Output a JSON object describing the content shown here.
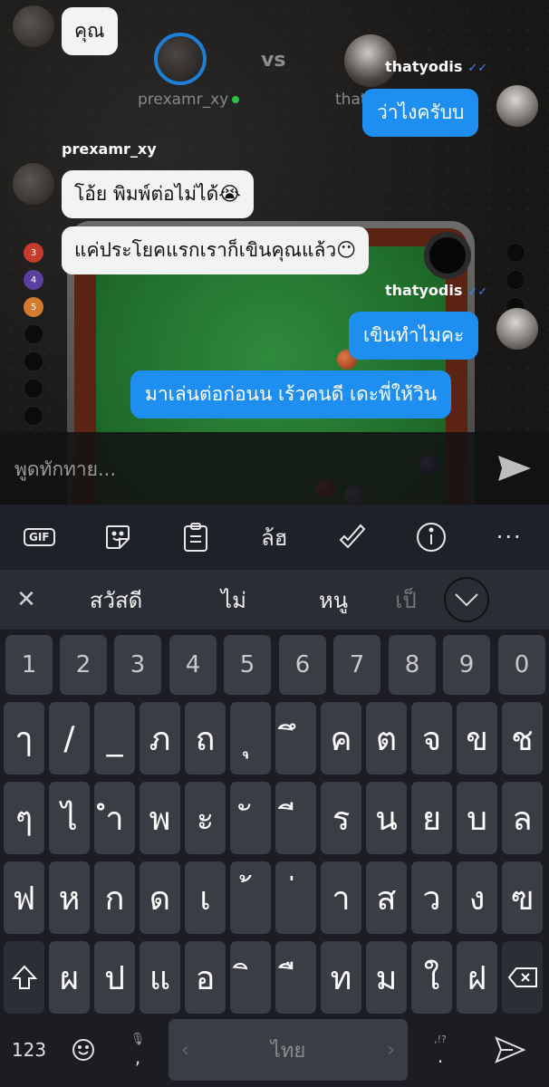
{
  "game": {
    "player1": {
      "name": "prexamr_xy"
    },
    "vs_label": "vs",
    "player2": {
      "name": "thatyodis",
      "name_partial": "that"
    },
    "rack_left": [
      "3",
      "4",
      "5"
    ]
  },
  "chat": {
    "messages": [
      {
        "sender": "",
        "text": "คุณ",
        "direction": "in"
      },
      {
        "sender": "thatyodis",
        "text": "ว่าไงครับบ",
        "direction": "out"
      },
      {
        "sender": "prexamr_xy",
        "text": "โอ้ย พิมพ์ต่อไม่ได้😭",
        "direction": "in"
      },
      {
        "sender": "",
        "text": "แค่ประโยคแรกเราก็เขินคุณแล้ว😶",
        "direction": "in"
      },
      {
        "sender": "thatyodis",
        "text": "เขินทำไมคะ",
        "direction": "out"
      },
      {
        "sender": "",
        "text": "มาเล่นต่อก่อนน เร้วคนดี เดะพี่ให้วิน",
        "direction": "out"
      }
    ],
    "input_placeholder": "พูดทักทาย..."
  },
  "keyboard": {
    "toolbar": [
      "gif-icon",
      "sticker-icon",
      "clipboard-icon",
      "translate-icon",
      "handwriting-icon",
      "info-icon",
      "more-icon"
    ],
    "gif_label": "GIF",
    "suggestions": [
      "สวัสดี",
      "ไม่",
      "หนู",
      "เป็"
    ],
    "number_row": [
      "1",
      "2",
      "3",
      "4",
      "5",
      "6",
      "7",
      "8",
      "9",
      "0"
    ],
    "row1": [
      "ๅ",
      "/",
      "_",
      "ภ",
      "ถ",
      "ุ",
      "ึ",
      "ค",
      "ต",
      "จ",
      "ข",
      "ช"
    ],
    "row2": [
      "ๆ",
      "ไ",
      "ำ",
      "พ",
      "ะ",
      "ั",
      "ี",
      "ร",
      "น",
      "ย",
      "บ",
      "ล"
    ],
    "row3": [
      "ฟ",
      "ห",
      "ก",
      "ด",
      "เ",
      "้",
      "่",
      "า",
      "ส",
      "ว",
      "ง",
      "ฃ"
    ],
    "row4": [
      "ผ",
      "ป",
      "แ",
      "อ",
      "ิ",
      "ื",
      "ท",
      "ม",
      "ใ",
      "ฝ"
    ],
    "bottom": {
      "numbers_label": "123",
      "comma": ",",
      "space_label": "ไทย",
      "period": ".",
      "punct_hint": ",!?"
    }
  }
}
